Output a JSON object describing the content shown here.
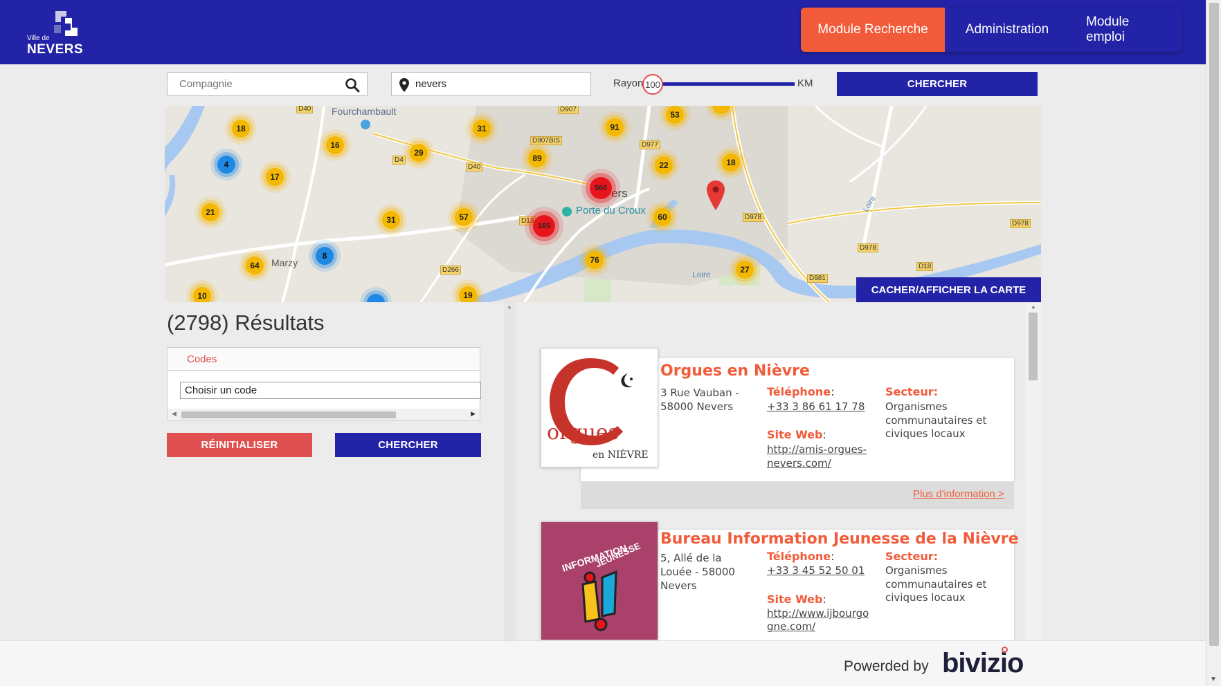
{
  "header": {
    "logo_small": "Ville de",
    "logo_name": "NEVERS",
    "nav": [
      {
        "label": "Module Recherche",
        "active": true
      },
      {
        "label": "Administration",
        "active": false
      },
      {
        "label": "Module emploi",
        "active": false
      }
    ]
  },
  "search": {
    "company_placeholder": "Compagnie",
    "location_value": "nevers",
    "radius_label": "Rayon",
    "radius_value": "100",
    "radius_unit": "KM",
    "submit_label": "CHERCHER"
  },
  "map": {
    "toggle_label": "CACHER/AFFICHER LA CARTE",
    "places": [
      {
        "name": "Fourchambault"
      },
      {
        "name": "Porte du Croux"
      },
      {
        "name": "Marzy"
      },
      {
        "name": "Nevers partial",
        "text": "ers"
      },
      {
        "name": "Loire 1",
        "text": "Loire"
      },
      {
        "name": "Loire 2",
        "text": "Loire"
      }
    ],
    "roads": [
      "D40",
      "D907",
      "D907BIS",
      "D977",
      "D40",
      "D4",
      "D13",
      "D266",
      "D978",
      "D978",
      "D978",
      "D18",
      "D981"
    ],
    "clusters": [
      {
        "count": "18",
        "color": "#f5b800"
      },
      {
        "count": "16",
        "color": "#f5b800"
      },
      {
        "count": "31",
        "color": "#f5b800"
      },
      {
        "count": "91",
        "color": "#f5b800"
      },
      {
        "count": "53",
        "color": "#f5b800"
      },
      {
        "count": "29",
        "color": "#f5b800"
      },
      {
        "count": "89",
        "color": "#f5b800"
      },
      {
        "count": "22",
        "color": "#f5b800"
      },
      {
        "count": "18",
        "color": "#f5b800"
      },
      {
        "count": "4",
        "color": "#1e88e5"
      },
      {
        "count": "17",
        "color": "#f5b800"
      },
      {
        "count": "560",
        "color": "#e8141c"
      },
      {
        "count": "21",
        "color": "#f5b800"
      },
      {
        "count": "31",
        "color": "#f5b800"
      },
      {
        "count": "57",
        "color": "#f5b800"
      },
      {
        "count": "165",
        "color": "#e8141c"
      },
      {
        "count": "60",
        "color": "#f5b800"
      },
      {
        "count": "8",
        "color": "#1e88e5"
      },
      {
        "count": "64",
        "color": "#f5b800"
      },
      {
        "count": "76",
        "color": "#f5b800"
      },
      {
        "count": "27",
        "color": "#f5b800"
      },
      {
        "count": "10",
        "color": "#f5b800"
      },
      {
        "count": "19",
        "color": "#f5b800"
      }
    ]
  },
  "filters": {
    "results_title": "(2798) Résultats",
    "codes_label": "Codes",
    "codes_select": "Choisir un code",
    "reset_label": "RÉINITIALISER",
    "search_label": "CHERCHER"
  },
  "cards": [
    {
      "title": "Orgues en Nièvre",
      "address": [
        "3 Rue Vauban -",
        "58000 Nevers"
      ],
      "phone_label": "Téléphone",
      "phone": "+33 3 86 61 17 78",
      "web_label": "Site Web",
      "web": [
        "http://amis-orgues-",
        "nevers.com/"
      ],
      "sector_label": "Secteur:",
      "sector": [
        "Organismes",
        "communautaires et",
        "civiques locaux"
      ],
      "more": "Plus d'information >",
      "logo_text": {
        "big": "orgues",
        "small": "en NIÈVRE"
      }
    },
    {
      "title": "Bureau Information Jeunesse de la Nièvre",
      "address": [
        "5, Allé de la",
        "Louée - 58000",
        "Nevers"
      ],
      "phone_label": "Téléphone",
      "phone": "+33 3 45 52 50 01",
      "web_label": "Site Web",
      "web": [
        "http://www.ijbourgo",
        "gne.com/"
      ],
      "sector_label": "Secteur:",
      "sector": [
        "Organismes",
        "communautaires et",
        "civiques locaux"
      ],
      "logo_text": {
        "line1": "INFORMATION",
        "line2": "JEUNESSE"
      }
    }
  ],
  "footer": {
    "powered": "Powerded by",
    "brand": "bivizio"
  },
  "colors": {
    "primary": "#2323a8",
    "accent": "#f25b3a",
    "reset": "#e05050"
  }
}
